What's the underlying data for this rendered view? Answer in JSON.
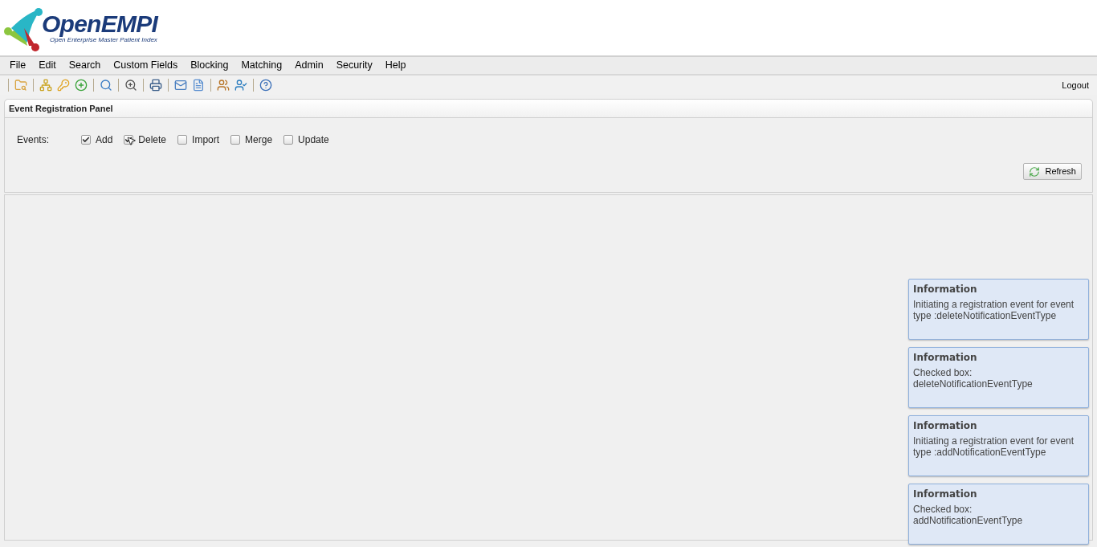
{
  "logo": {
    "name": "OpenEMPI",
    "tagline": "Open Enterprise Master Patient Index"
  },
  "menu": [
    "File",
    "Edit",
    "Search",
    "Custom Fields",
    "Blocking",
    "Matching",
    "Admin",
    "Security",
    "Help"
  ],
  "toolbar": {
    "logout": "Logout"
  },
  "panel": {
    "title": "Event Registration Panel",
    "events_label": "Events:",
    "events": [
      {
        "label": "Add",
        "checked": true
      },
      {
        "label": "Delete",
        "checked": true
      },
      {
        "label": "Import",
        "checked": false
      },
      {
        "label": "Merge",
        "checked": false
      },
      {
        "label": "Update",
        "checked": false
      }
    ],
    "refresh": "Refresh"
  },
  "notifications": [
    {
      "title": "Information",
      "message": "Initiating a registration event for event type :deleteNotificationEventType"
    },
    {
      "title": "Information",
      "message": "Checked box: deleteNotificationEventType"
    },
    {
      "title": "Information",
      "message": "Initiating a registration event for event type :addNotificationEventType"
    },
    {
      "title": "Information",
      "message": "Checked box: addNotificationEventType"
    }
  ]
}
